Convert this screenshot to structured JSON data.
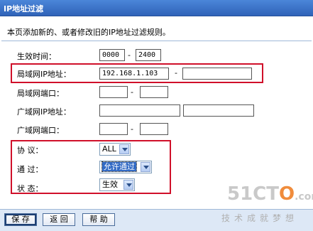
{
  "window": {
    "title": "IP地址过滤"
  },
  "description": "本页添加新的、或者修改旧的IP地址过滤规则。",
  "form": {
    "effective_time": {
      "label": "生效时间：",
      "start": "0000",
      "end": "2400"
    },
    "lan_ip": {
      "label": "局域网IP地址：",
      "start": "192.168.1.103",
      "end": ""
    },
    "lan_port": {
      "label": "局域网端口：",
      "start": "",
      "end": ""
    },
    "wan_ip": {
      "label": "广域网IP地址：",
      "start": "",
      "end": ""
    },
    "wan_port": {
      "label": "广域网端口：",
      "start": "",
      "end": ""
    },
    "protocol": {
      "label": "协  议：",
      "value": "ALL"
    },
    "pass": {
      "label": "通  过：",
      "value": "允许通过"
    },
    "status": {
      "label": "状  态：",
      "value": "生效"
    },
    "range_separator": "-"
  },
  "buttons": {
    "save": "保 存",
    "back": "返 回",
    "help": "帮 助"
  },
  "watermark": {
    "logo_prefix": "51CT",
    "logo_o": "O",
    "logo_suffix": ".com",
    "tagline": "技术成就梦想"
  },
  "colors": {
    "title_bar": "#2f63b8",
    "highlight_box": "#d0102a",
    "selected": "#316ac5"
  }
}
